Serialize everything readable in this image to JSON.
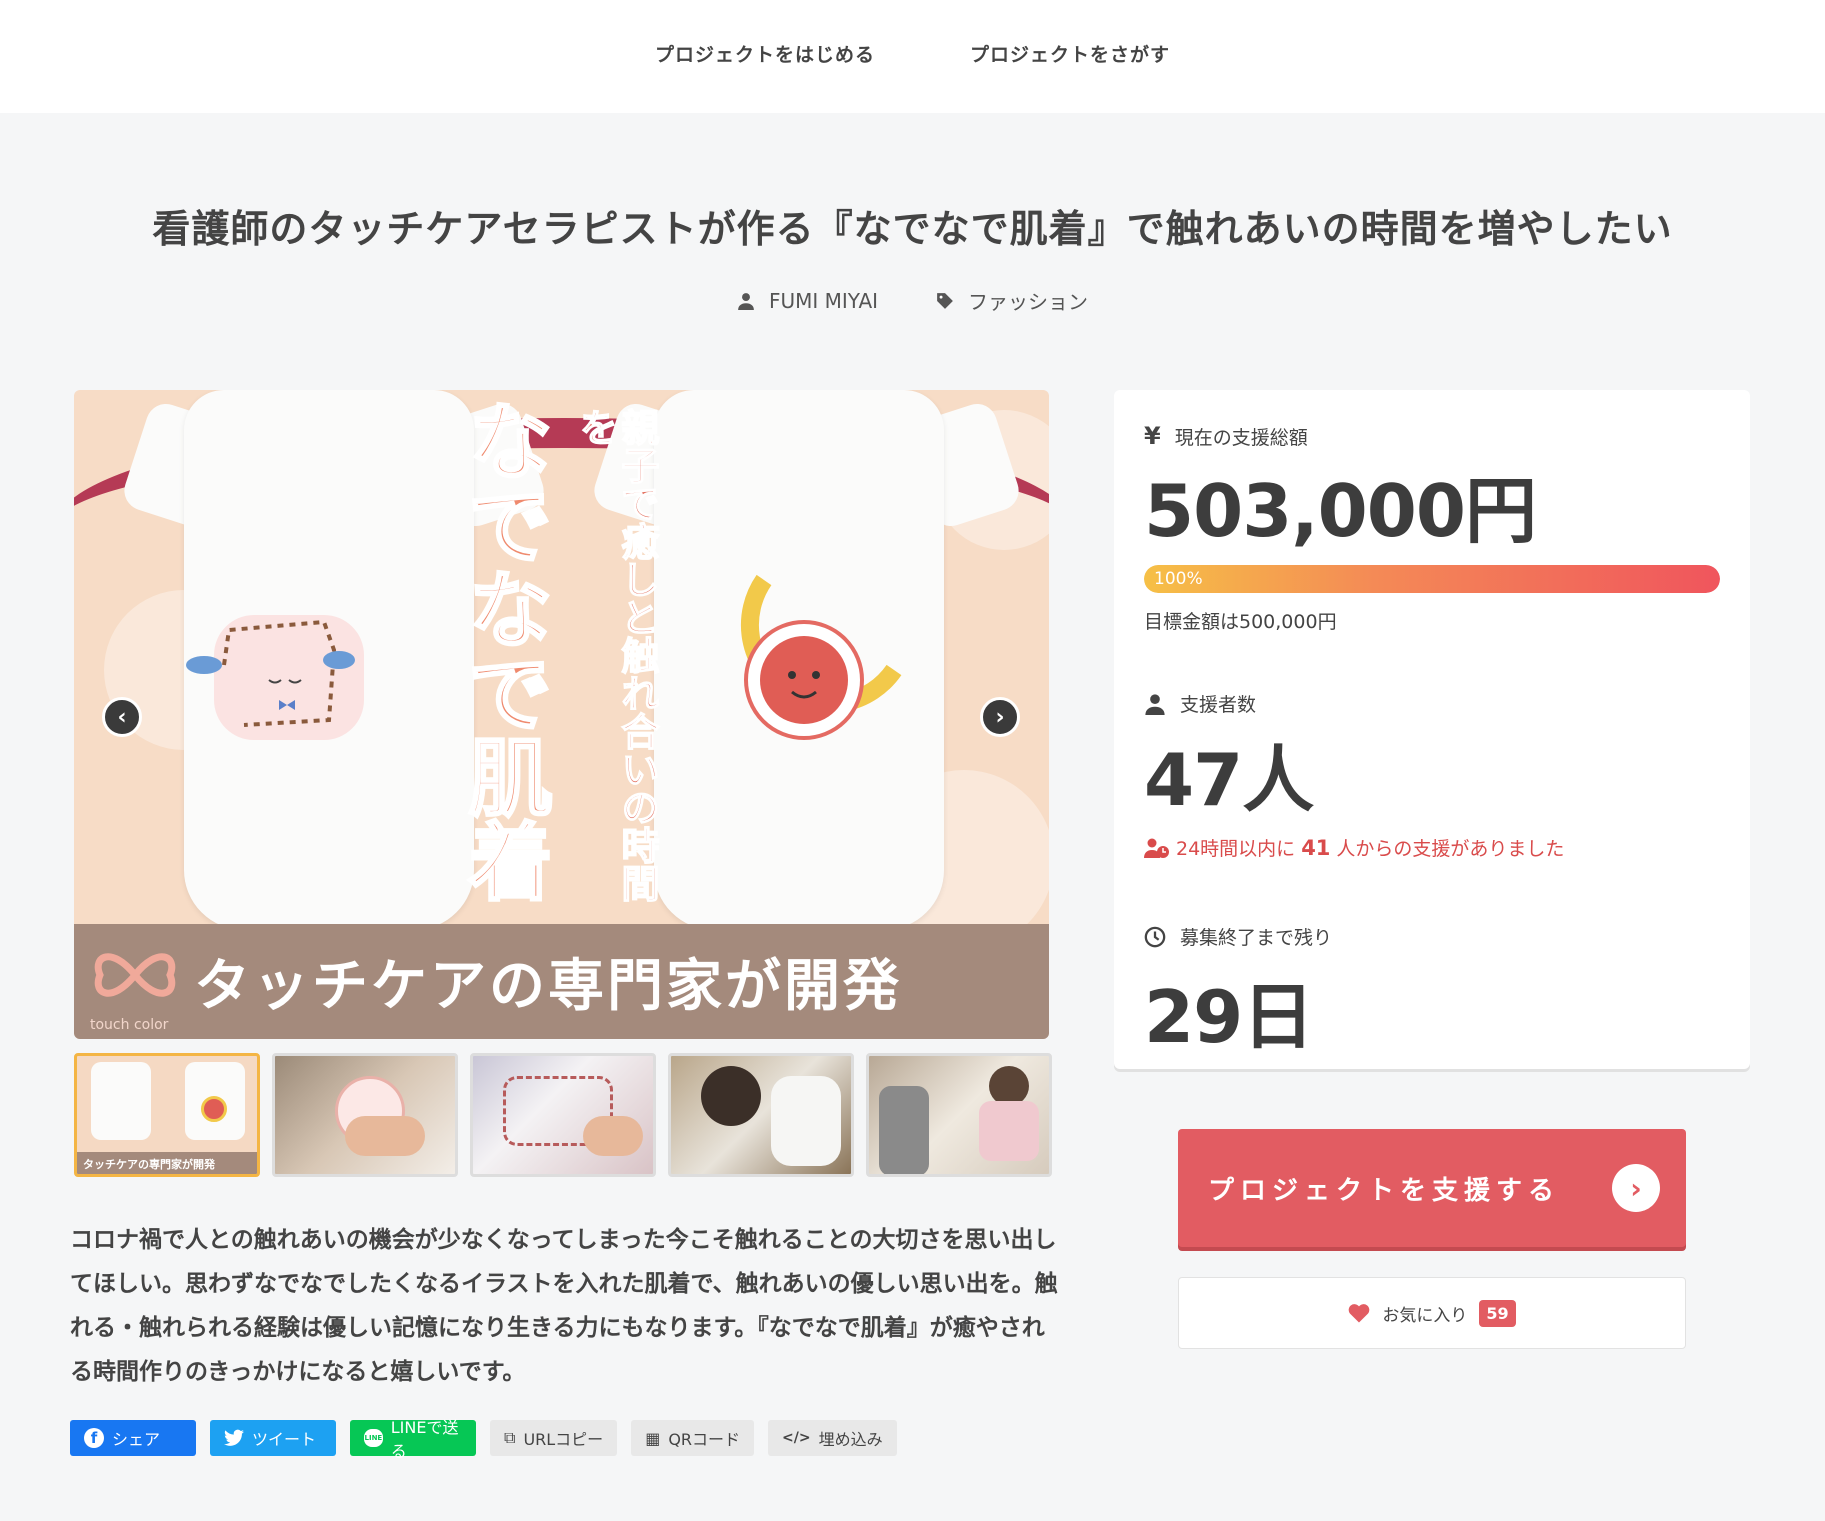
{
  "nav": {
    "start_project": "プロジェクトをはじめる",
    "find_project": "プロジェクトをさがす"
  },
  "project": {
    "title": "看護師のタッチケアセラピストが作る『なでなで肌着』で触れあいの時間を増やしたい",
    "author": "FUMI MIYAI",
    "category": "ファッション",
    "description": "コロナ禍で人との触れあいの機会が少なくなってしまった今こそ触れることの大切さを思い出してほしい。思わずなでなでしたくなるイラストを入れた肌着で、触れあいの優しい思い出を。触れる・触れられる経験は優しい記憶になり生きる力にもなります。『なでなで肌着』が癒やされる時間作りのきっかけになると嬉しいです。"
  },
  "hero": {
    "vertical_main": "なでなで肌着",
    "vertical_sub": "親子で癒しと触れ合いの時間を",
    "banner_text": "タッチケアの専門家が開発",
    "brand": "touch color",
    "prev_icon": "chevron-left-icon",
    "next_icon": "chevron-right-icon"
  },
  "thumbnails": [
    {
      "label": "タッチケアの専門家が開発",
      "active": true
    },
    {
      "label": "",
      "active": false
    },
    {
      "label": "",
      "active": false
    },
    {
      "label": "",
      "active": false
    },
    {
      "label": "",
      "active": false
    }
  ],
  "share": {
    "facebook": "シェア",
    "twitter": "ツイート",
    "line": "LINEで送る",
    "url_copy": "URLコピー",
    "qr_code": "QRコード",
    "embed": "埋め込み"
  },
  "stats": {
    "total_label": "現在の支援総額",
    "total_value": "503,000円",
    "progress_percent": 100,
    "progress_label": "100%",
    "goal_text": "目標金額は500,000円",
    "backers_label": "支援者数",
    "backers_value": "47人",
    "recent_prefix": "24時間以内に",
    "recent_count": "41",
    "recent_suffix": "人からの支援がありました",
    "remaining_label": "募集終了まで残り",
    "remaining_value": "29日"
  },
  "actions": {
    "support_label": "プロジェクトを支援する",
    "favorite_label": "お気に入り",
    "favorite_count": "59"
  },
  "colors": {
    "accent": "#e25c62",
    "progress_start": "#f6c046",
    "progress_end": "#f0555d",
    "highlight_text": "#d94b4b"
  }
}
